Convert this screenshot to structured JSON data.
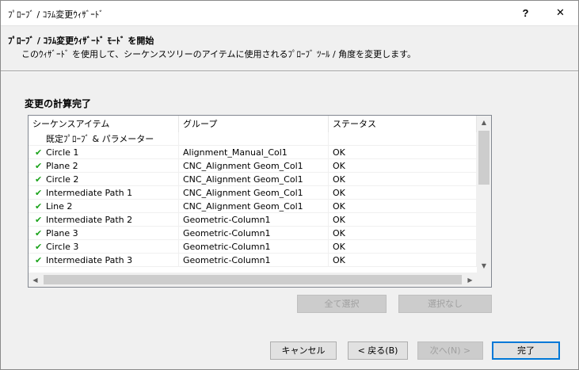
{
  "window": {
    "title": "ﾌﾟﾛｰﾌﾞ / ｺﾗﾑ変更ｳｨｻﾞｰﾄﾞ",
    "help_label": "?",
    "close_label": "✕"
  },
  "header": {
    "title": "ﾌﾟﾛｰﾌﾞ / ｺﾗﾑ変更ｳｨｻﾞｰﾄﾞ ﾓｰﾄﾞ を開始",
    "description": "このｳｨｻﾞｰﾄﾞ を使用して、シーケンスツリーのアイテムに使用されるﾌﾟﾛｰﾌﾞ ﾂｰﾙ / 角度を変更します。"
  },
  "section_title": "変更の計算完了",
  "list": {
    "columns": [
      "シーケンスアイテム",
      "グループ",
      "ステータス"
    ],
    "group_label": "既定ﾌﾟﾛｰﾌﾞ & パラメーター",
    "check_icon": "✔",
    "rows": [
      {
        "item": "Circle 1",
        "group": "Alignment_Manual_Col1",
        "status": "OK"
      },
      {
        "item": "Plane 2",
        "group": "CNC_Alignment Geom_Col1",
        "status": "OK"
      },
      {
        "item": "Circle 2",
        "group": "CNC_Alignment Geom_Col1",
        "status": "OK"
      },
      {
        "item": "Intermediate Path 1",
        "group": "CNC_Alignment Geom_Col1",
        "status": "OK"
      },
      {
        "item": "Line 2",
        "group": "CNC_Alignment Geom_Col1",
        "status": "OK"
      },
      {
        "item": "Intermediate Path 2",
        "group": "Geometric-Column1",
        "status": "OK"
      },
      {
        "item": "Plane 3",
        "group": "Geometric-Column1",
        "status": "OK"
      },
      {
        "item": "Circle 3",
        "group": "Geometric-Column1",
        "status": "OK"
      },
      {
        "item": "Intermediate Path 3",
        "group": "Geometric-Column1",
        "status": "OK"
      }
    ]
  },
  "selection_buttons": {
    "select_all": "全て選択",
    "select_none": "選択なし"
  },
  "footer": {
    "cancel": "キャンセル",
    "back": "< 戻る(B)",
    "next": "次へ(N) >",
    "finish": "完了"
  },
  "colors": {
    "check_green": "#1aa31a",
    "default_button_border": "#0078d7"
  }
}
